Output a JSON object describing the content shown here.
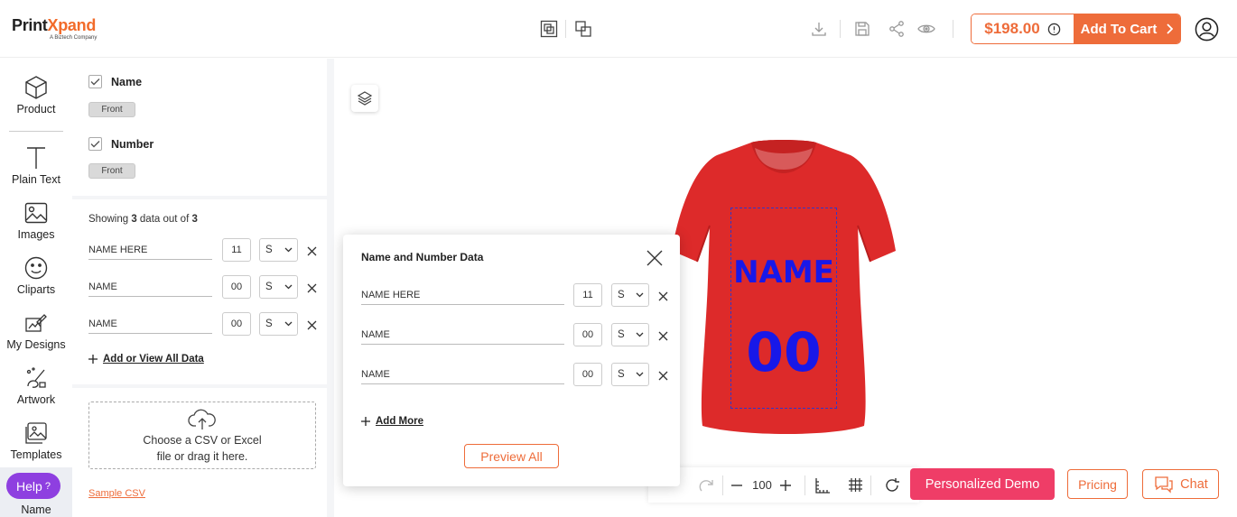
{
  "brand": {
    "logo_part1": "Print",
    "logo_part2": "Xpand",
    "tagline": "A Biztech Company",
    "accent": "#ee6c3a"
  },
  "header": {
    "price": "$198.00",
    "add_to_cart": "Add To Cart"
  },
  "sidebar": {
    "items": [
      {
        "label": "Product",
        "icon": "cube-icon"
      },
      {
        "label": "Plain Text",
        "icon": "text-icon"
      },
      {
        "label": "Images",
        "icon": "image-icon"
      },
      {
        "label": "Cliparts",
        "icon": "smiley-icon"
      },
      {
        "label": "My Designs",
        "icon": "designs-icon"
      },
      {
        "label": "Artwork",
        "icon": "artwork-icon"
      },
      {
        "label": "Templates",
        "icon": "templates-icon"
      }
    ],
    "help_label": "Help",
    "help_mark": "?",
    "active_label": "Name"
  },
  "panel": {
    "options": [
      {
        "label": "Name",
        "checked": true,
        "side": "Front"
      },
      {
        "label": "Number",
        "checked": true,
        "side": "Front"
      }
    ],
    "showing_prefix": "Showing ",
    "showing_count": "3",
    "showing_middle": " data out of ",
    "showing_total": "3",
    "rows": [
      {
        "name": "NAME HERE",
        "number": "11",
        "size": "S"
      },
      {
        "name": "NAME",
        "number": "00",
        "size": "S"
      },
      {
        "name": "NAME",
        "number": "00",
        "size": "S"
      }
    ],
    "add_view_label": "Add or View All Data",
    "upload_line1": "Choose a CSV or Excel",
    "upload_line2": "file or drag it here.",
    "sample_csv": "Sample CSV"
  },
  "canvas": {
    "shirt_name": "NAME",
    "shirt_number": "00",
    "shirt_color": "#dd2a2a",
    "text_color": "#1818e8"
  },
  "toolbar": {
    "zoom": "100"
  },
  "buttons": {
    "demo": "Personalized Demo",
    "pricing": "Pricing",
    "chat": "Chat"
  },
  "modal": {
    "title": "Name and Number Data",
    "rows": [
      {
        "name": "NAME HERE",
        "number": "11",
        "size": "S"
      },
      {
        "name": "NAME",
        "number": "00",
        "size": "S"
      },
      {
        "name": "NAME",
        "number": "00",
        "size": "S"
      }
    ],
    "add_more": "Add More",
    "preview_all": "Preview All"
  }
}
